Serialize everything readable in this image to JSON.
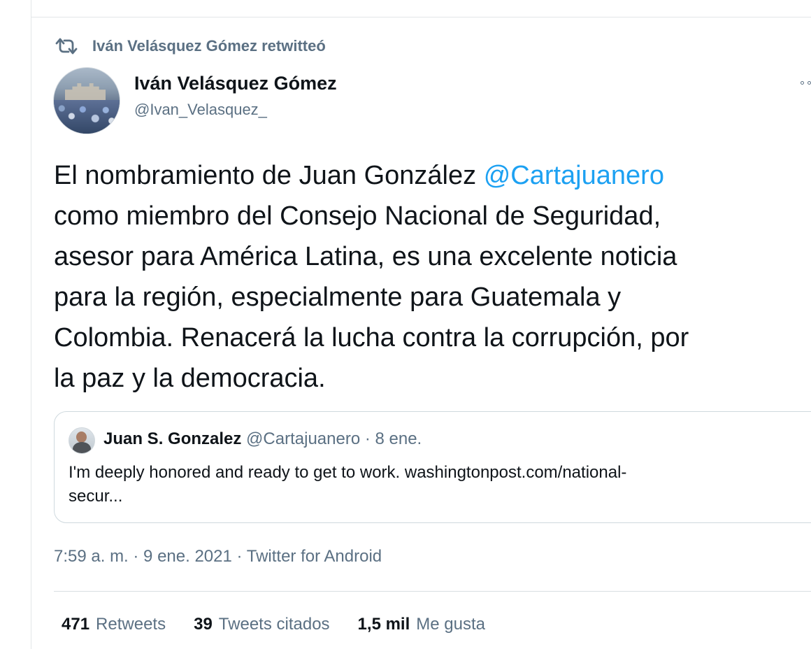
{
  "retweet_context": {
    "label": "Iván Velásquez Gómez retwitteó",
    "icon": "retweet-icon"
  },
  "author": {
    "name": "Iván Velásquez Gómez",
    "handle": "@Ivan_Velasquez_",
    "avatar_icon": "profile-photo-avatar"
  },
  "tweet": {
    "lines": [
      {
        "prefix": "El nombramiento de Juan González ",
        "mention": "@Cartajuanero",
        "suffix": ""
      },
      {
        "prefix": "como miembro del Consejo Nacional de Seguridad,",
        "mention": "",
        "suffix": ""
      },
      {
        "prefix": "asesor para América Latina, es una excelente noticia",
        "mention": "",
        "suffix": ""
      },
      {
        "prefix": "para la región, especialmente para Guatemala y",
        "mention": "",
        "suffix": ""
      },
      {
        "prefix": "Colombia. Renacerá la lucha contra la corrupción, por",
        "mention": "",
        "suffix": ""
      },
      {
        "prefix": "la paz y la democracia.",
        "mention": "",
        "suffix": ""
      }
    ]
  },
  "quote": {
    "name": "Juan S. Gonzalez",
    "handle_date": " @Cartajuanero · 8 ene.",
    "text_lines": [
      "I'm deeply honored and ready to get to work. washingtonpost.com/national-",
      "secur..."
    ],
    "avatar_icon": "quoted-user-avatar"
  },
  "meta": {
    "timestamp_source": "7:59 a. m. · 9 ene. 2021 · Twitter for Android"
  },
  "stats": {
    "retweets": {
      "value": "471",
      "label": "Retweets"
    },
    "quote_tweets": {
      "value": "39",
      "label": "Tweets citados"
    },
    "likes": {
      "value": "1,5 mil",
      "label": "Me gusta"
    }
  },
  "colors": {
    "text": "#0f1419",
    "secondary": "#5b7083",
    "link": "#1da1f2",
    "border": "#cfd9de"
  },
  "icons": {
    "retweet": "retweet-icon",
    "more": "more-options-icon"
  }
}
